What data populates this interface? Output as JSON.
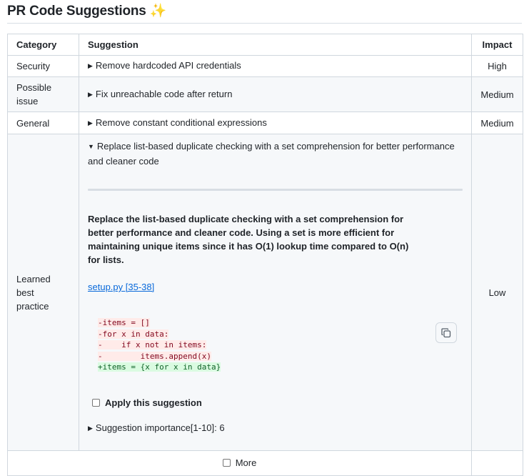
{
  "title": "PR Code Suggestions",
  "title_emoji": "✨",
  "table": {
    "headers": {
      "category": "Category",
      "suggestion": "Suggestion",
      "impact": "Impact"
    },
    "rows": [
      {
        "category": "Security",
        "suggestion": "Remove hardcoded API credentials",
        "impact": "High"
      },
      {
        "category": "Possible issue",
        "suggestion": "Fix unreachable code after return",
        "impact": "Medium"
      },
      {
        "category": "General",
        "suggestion": "Remove constant conditional expressions",
        "impact": "Medium"
      }
    ],
    "expanded": {
      "category": "Learned best practice",
      "summary": "Replace list-based duplicate checking with a set comprehension for better performance and cleaner code",
      "description": "Replace the list-based duplicate checking with a set comprehension for better performance and cleaner code. Using a set is more efficient for maintaining unique items since it has O(1) lookup time compared to O(n) for lists.",
      "file_link": "setup.py [35-38]",
      "code_lines": [
        {
          "type": "del",
          "text": "-items = []"
        },
        {
          "type": "del",
          "text": "-for x in data:"
        },
        {
          "type": "del",
          "text": "-    if x not in items:"
        },
        {
          "type": "del",
          "text": "-        items.append(x)"
        },
        {
          "type": "add",
          "text": "+items = {x for x in data}"
        }
      ],
      "apply_label": "Apply this suggestion",
      "importance_label": "Suggestion importance[1-10]: 6",
      "impact": "Low"
    },
    "more_label": "More"
  },
  "colors": {
    "deletion_bg": "#ffebe9",
    "addition_bg": "#dafbe1",
    "link": "#0969da",
    "border": "#d0d7de"
  },
  "icons": {
    "disclosure_closed": "triangle-right-icon",
    "disclosure_open": "triangle-down-icon",
    "copy": "copy-icon"
  }
}
